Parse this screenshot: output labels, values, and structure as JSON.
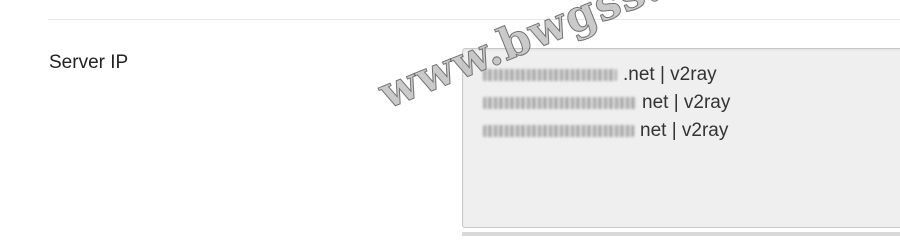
{
  "form": {
    "server_ip": {
      "label": "Server IP",
      "lines": [
        {
          "visible_text": ".net | v2ray"
        },
        {
          "visible_text": "net | v2ray"
        },
        {
          "visible_text": "net | v2ray"
        }
      ]
    }
  },
  "watermark": {
    "text": "www.bwgss.org"
  }
}
